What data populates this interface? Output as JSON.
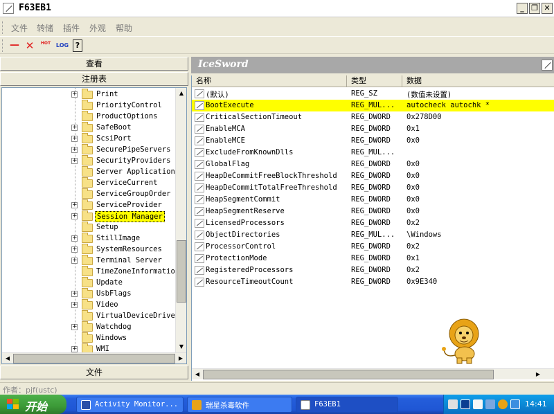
{
  "window": {
    "title": "F63EB1",
    "minimize": "_",
    "restore": "❐",
    "close": "✕"
  },
  "menu": [
    "文件",
    "转储",
    "插件",
    "外观",
    "帮助"
  ],
  "toolbar": {
    "dash": "—",
    "close": "✕",
    "hot": "HOT",
    "log": "LOG",
    "help": "?"
  },
  "left": {
    "view_header": "查看",
    "registry_header": "注册表",
    "file_header": "文件",
    "tree": [
      {
        "label": "Print",
        "expandable": true
      },
      {
        "label": "PriorityControl",
        "expandable": false
      },
      {
        "label": "ProductOptions",
        "expandable": false
      },
      {
        "label": "SafeBoot",
        "expandable": true
      },
      {
        "label": "ScsiPort",
        "expandable": true
      },
      {
        "label": "SecurePipeServers",
        "expandable": true
      },
      {
        "label": "SecurityProviders",
        "expandable": true
      },
      {
        "label": "Server Applications",
        "expandable": false
      },
      {
        "label": "ServiceCurrent",
        "expandable": false
      },
      {
        "label": "ServiceGroupOrder",
        "expandable": false
      },
      {
        "label": "ServiceProvider",
        "expandable": true
      },
      {
        "label": "Session Manager",
        "expandable": true,
        "selected": true
      },
      {
        "label": "Setup",
        "expandable": false
      },
      {
        "label": "StillImage",
        "expandable": true
      },
      {
        "label": "SystemResources",
        "expandable": true
      },
      {
        "label": "Terminal Server",
        "expandable": true
      },
      {
        "label": "TimeZoneInformation",
        "expandable": false
      },
      {
        "label": "Update",
        "expandable": false
      },
      {
        "label": "UsbFlags",
        "expandable": true
      },
      {
        "label": "Video",
        "expandable": true
      },
      {
        "label": "VirtualDeviceDrivers",
        "expandable": false
      },
      {
        "label": "Watchdog",
        "expandable": true
      },
      {
        "label": "Windows",
        "expandable": false
      },
      {
        "label": "WMI",
        "expandable": true
      }
    ]
  },
  "right": {
    "title": "IceSword",
    "columns": [
      "名称",
      "类型",
      "数据"
    ],
    "rows": [
      {
        "name": "(默认)",
        "type": "REG_SZ",
        "data": "(数值未设置)"
      },
      {
        "name": "BootExecute",
        "type": "REG_MUL...",
        "data": "autocheck autochk *",
        "highlight": true
      },
      {
        "name": "CriticalSectionTimeout",
        "type": "REG_DWORD",
        "data": "0x278D00"
      },
      {
        "name": "EnableMCA",
        "type": "REG_DWORD",
        "data": "0x1"
      },
      {
        "name": "EnableMCE",
        "type": "REG_DWORD",
        "data": "0x0"
      },
      {
        "name": "ExcludeFromKnownDlls",
        "type": "REG_MUL...",
        "data": ""
      },
      {
        "name": "GlobalFlag",
        "type": "REG_DWORD",
        "data": "0x0"
      },
      {
        "name": "HeapDeCommitFreeBlockThreshold",
        "type": "REG_DWORD",
        "data": "0x0"
      },
      {
        "name": "HeapDeCommitTotalFreeThreshold",
        "type": "REG_DWORD",
        "data": "0x0"
      },
      {
        "name": "HeapSegmentCommit",
        "type": "REG_DWORD",
        "data": "0x0"
      },
      {
        "name": "HeapSegmentReserve",
        "type": "REG_DWORD",
        "data": "0x0"
      },
      {
        "name": "LicensedProcessors",
        "type": "REG_DWORD",
        "data": "0x2"
      },
      {
        "name": "ObjectDirectories",
        "type": "REG_MUL...",
        "data": "\\Windows"
      },
      {
        "name": "ProcessorControl",
        "type": "REG_DWORD",
        "data": "0x2"
      },
      {
        "name": "ProtectionMode",
        "type": "REG_DWORD",
        "data": "0x1"
      },
      {
        "name": "RegisteredProcessors",
        "type": "REG_DWORD",
        "data": "0x2"
      },
      {
        "name": "ResourceTimeoutCount",
        "type": "REG_DWORD",
        "data": "0x9E340"
      }
    ]
  },
  "status": {
    "text": "作者：pjf(ustc)"
  },
  "taskbar": {
    "start": "开始",
    "tasks": [
      {
        "label": "Activity Monitor..."
      },
      {
        "label": "瑞星杀毒软件"
      },
      {
        "label": "F63EB1",
        "active": true
      }
    ],
    "clock": "14:41"
  },
  "colors": {
    "highlight": "#ffff00",
    "title_bar": "#a8a8a8",
    "taskbar": "#245edb",
    "start": "#3c9a38"
  }
}
